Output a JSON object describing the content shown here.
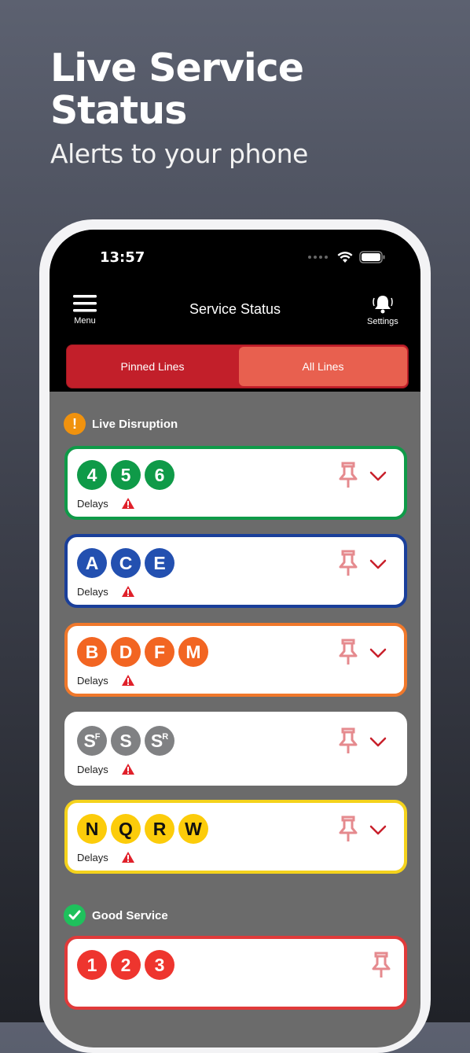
{
  "hero": {
    "title": "Live Service Status",
    "subtitle": "Alerts to your phone"
  },
  "statusbar": {
    "time": "13:57"
  },
  "nav": {
    "menu_label": "Menu",
    "title": "Service Status",
    "settings_label": "Settings"
  },
  "tabs": {
    "pinned": "Pinned Lines",
    "all": "All Lines",
    "selected": "All Lines"
  },
  "sections": {
    "disruption": "Live Disruption",
    "good": "Good Service"
  },
  "colors": {
    "green": "#0f9a48",
    "blue": "#2350b0",
    "orange": "#f26522",
    "gray": "#808183",
    "yellow": "#fccc0a",
    "red": "#ee352e",
    "accent": "#c21f2a"
  },
  "lines": [
    {
      "status": "Delays",
      "bullets": [
        "4",
        "5",
        "6"
      ],
      "color": "#0f9a48",
      "border": "#0f9a48",
      "text_color": "#fff"
    },
    {
      "status": "Delays",
      "bullets": [
        "A",
        "C",
        "E"
      ],
      "color": "#2350b0",
      "border": "#1a3f9a",
      "text_color": "#fff"
    },
    {
      "status": "Delays",
      "bullets": [
        "B",
        "D",
        "F",
        "M"
      ],
      "color": "#f26522",
      "border": "#f0782b",
      "text_color": "#fff"
    },
    {
      "status": "Delays",
      "bullets": [
        "S",
        "S",
        "S"
      ],
      "bullet_sup": [
        "F",
        "",
        "R"
      ],
      "color": "#808183",
      "border": "#ffffff",
      "text_color": "#fff"
    },
    {
      "status": "Delays",
      "bullets": [
        "N",
        "Q",
        "R",
        "W"
      ],
      "color": "#fccc0a",
      "border": "#f4d21c",
      "text_color": "#111"
    },
    {
      "status": "",
      "bullets": [
        "1",
        "2",
        "3"
      ],
      "color": "#ee352e",
      "border": "#e03a3a",
      "text_color": "#fff"
    }
  ]
}
